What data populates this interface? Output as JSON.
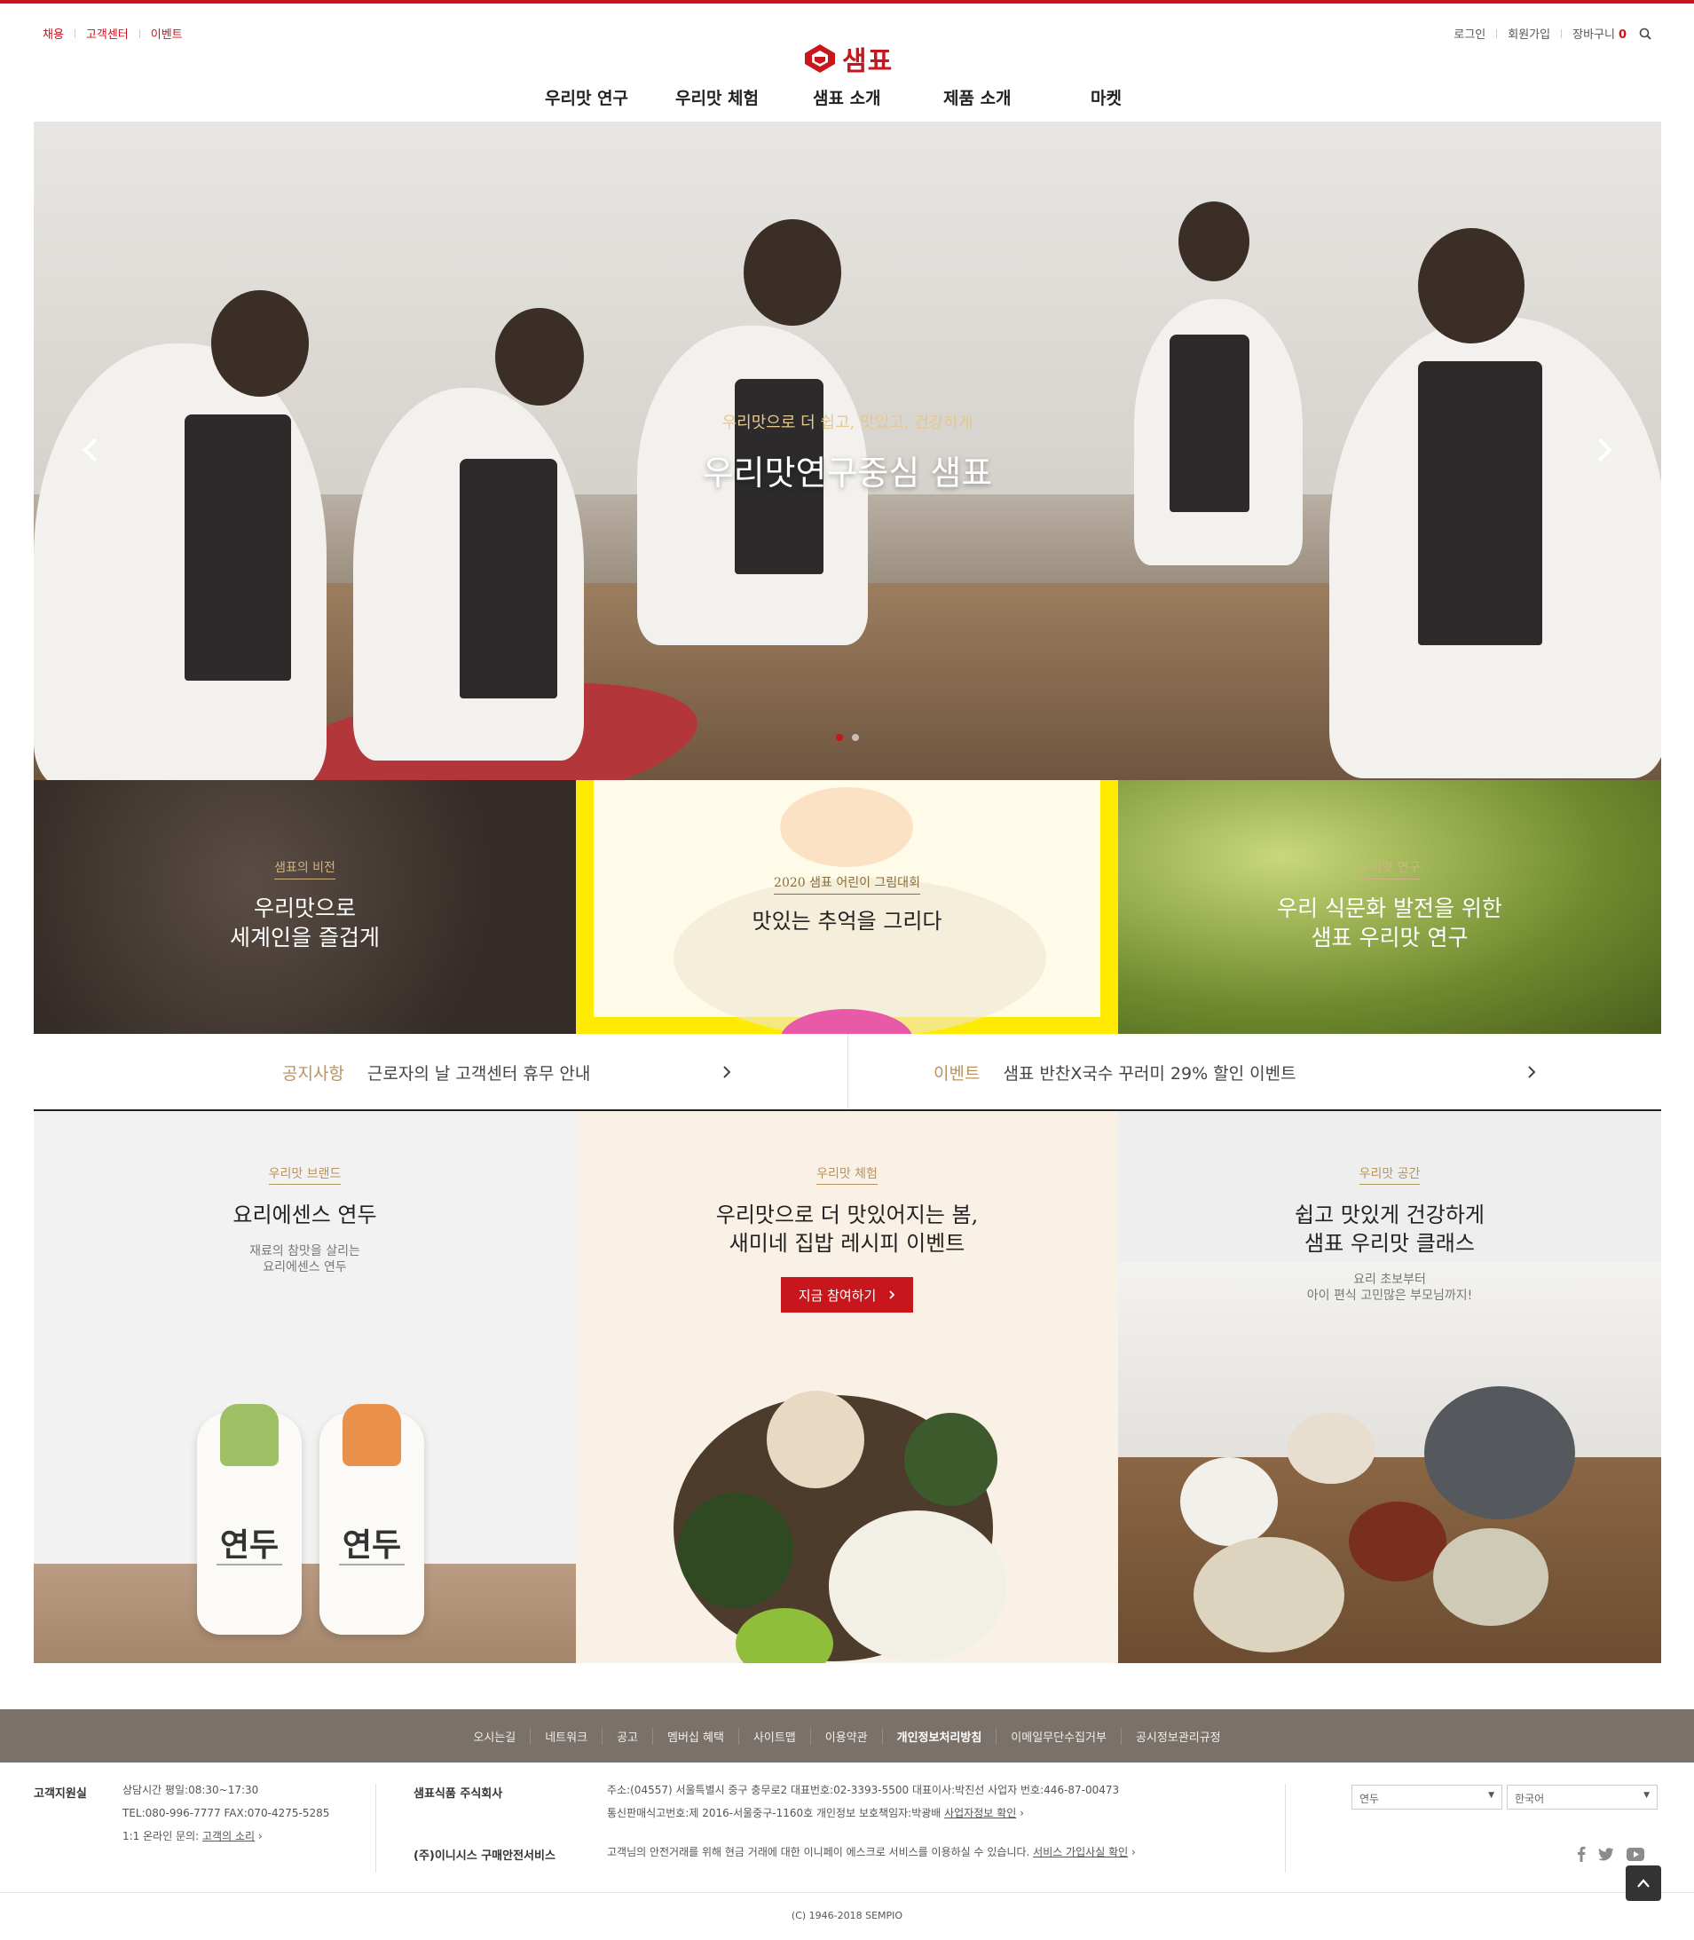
{
  "utility": {
    "left": [
      "채용",
      "고객센터",
      "이벤트"
    ],
    "login": "로그인",
    "join": "회원가입",
    "cart": "장바구니",
    "cart_count": "0"
  },
  "logo": {
    "text": "샘표"
  },
  "nav": [
    "우리맛 연구",
    "우리맛 체험",
    "샘표 소개",
    "제품 소개",
    "마켓"
  ],
  "hero": {
    "subtitle": "우리맛으로 더 쉽고, 맛있고, 건강하게",
    "title": "우리맛연구중심 샘표",
    "slides_total": 2,
    "active_slide": 1
  },
  "promos": [
    {
      "tag": "샘표의 비전",
      "title_line1": "우리맛으로",
      "title_line2": "세계인을 즐겁게"
    },
    {
      "tag": "2020 샘표 어린이 그림대회",
      "title_line1": "맛있는 추억을 그리다",
      "title_line2": ""
    },
    {
      "tag": "우리맛 연구",
      "title_line1": "우리 식문화 발전을 위한",
      "title_line2": "샘표 우리맛 연구"
    }
  ],
  "notices": [
    {
      "label": "공지사항",
      "text": "근로자의 날 고객센터 휴무 안내"
    },
    {
      "label": "이벤트",
      "text": "샘표 반찬X국수 꾸러미 29% 할인 이벤트"
    }
  ],
  "features": [
    {
      "tag": "우리맛 브랜드",
      "title_line1": "요리에센스 연두",
      "title_line2": "",
      "desc_line1": "재료의 참맛을 살리는",
      "desc_line2": "요리에센스 연두",
      "bottle_label": "연두"
    },
    {
      "tag": "우리맛 체험",
      "title_line1": "우리맛으로 더 맛있어지는 봄,",
      "title_line2": "새미네 집밥 레시피 이벤트",
      "cta": "지금 참여하기"
    },
    {
      "tag": "우리맛 공간",
      "title_line1": "쉽고 맛있게 건강하게",
      "title_line2": "샘표 우리맛 클래스",
      "desc_line1": "요리 초보부터",
      "desc_line2": "아이 편식 고민많은 부모님까지!"
    }
  ],
  "footer": {
    "links": [
      "오시는길",
      "네트워크",
      "공고",
      "멤버십 혜택",
      "사이트맵",
      "이용약관",
      "개인정보처리방침",
      "이메일무단수집거부",
      "공시정보관리규정"
    ],
    "cs_title": "고객지원실",
    "cs_hours": "상담시간 평일:08:30~17:30",
    "cs_tel": "TEL:080-996-7777   FAX:070-4275-5285",
    "cs_online_prefix": "1:1 온라인 문의:",
    "cs_online_link": "고객의 소리",
    "company_title": "샘표식품 주식회사",
    "company_line1": "주소:(04557) 서울특별시 중구 충무로2   대표번호:02-3393-5500   대표이사:박진선   사업자 번호:446-87-00473",
    "company_line2_prefix": "통신판매식고번호:제 2016-서울중구-1160호   개인정보 보호책임자:박광배",
    "company_line2_link": "사업자정보 확인",
    "escrow_title": "(주)이니시스 구매안전서비스",
    "escrow_text": "고객님의 안전거래를 위해 현금 거래에 대한 이니페이 에스크로 서비스를 이용하실 수 있습니다.",
    "escrow_link": "서비스 가입사실 확인",
    "select_family": "연두",
    "select_lang": "한국어",
    "copyright": "(C) 1946-2018 SEMPIO"
  },
  "colors": {
    "brand_red": "#c8161d",
    "gold": "#b79360",
    "footer_bar": "#7a716a"
  }
}
